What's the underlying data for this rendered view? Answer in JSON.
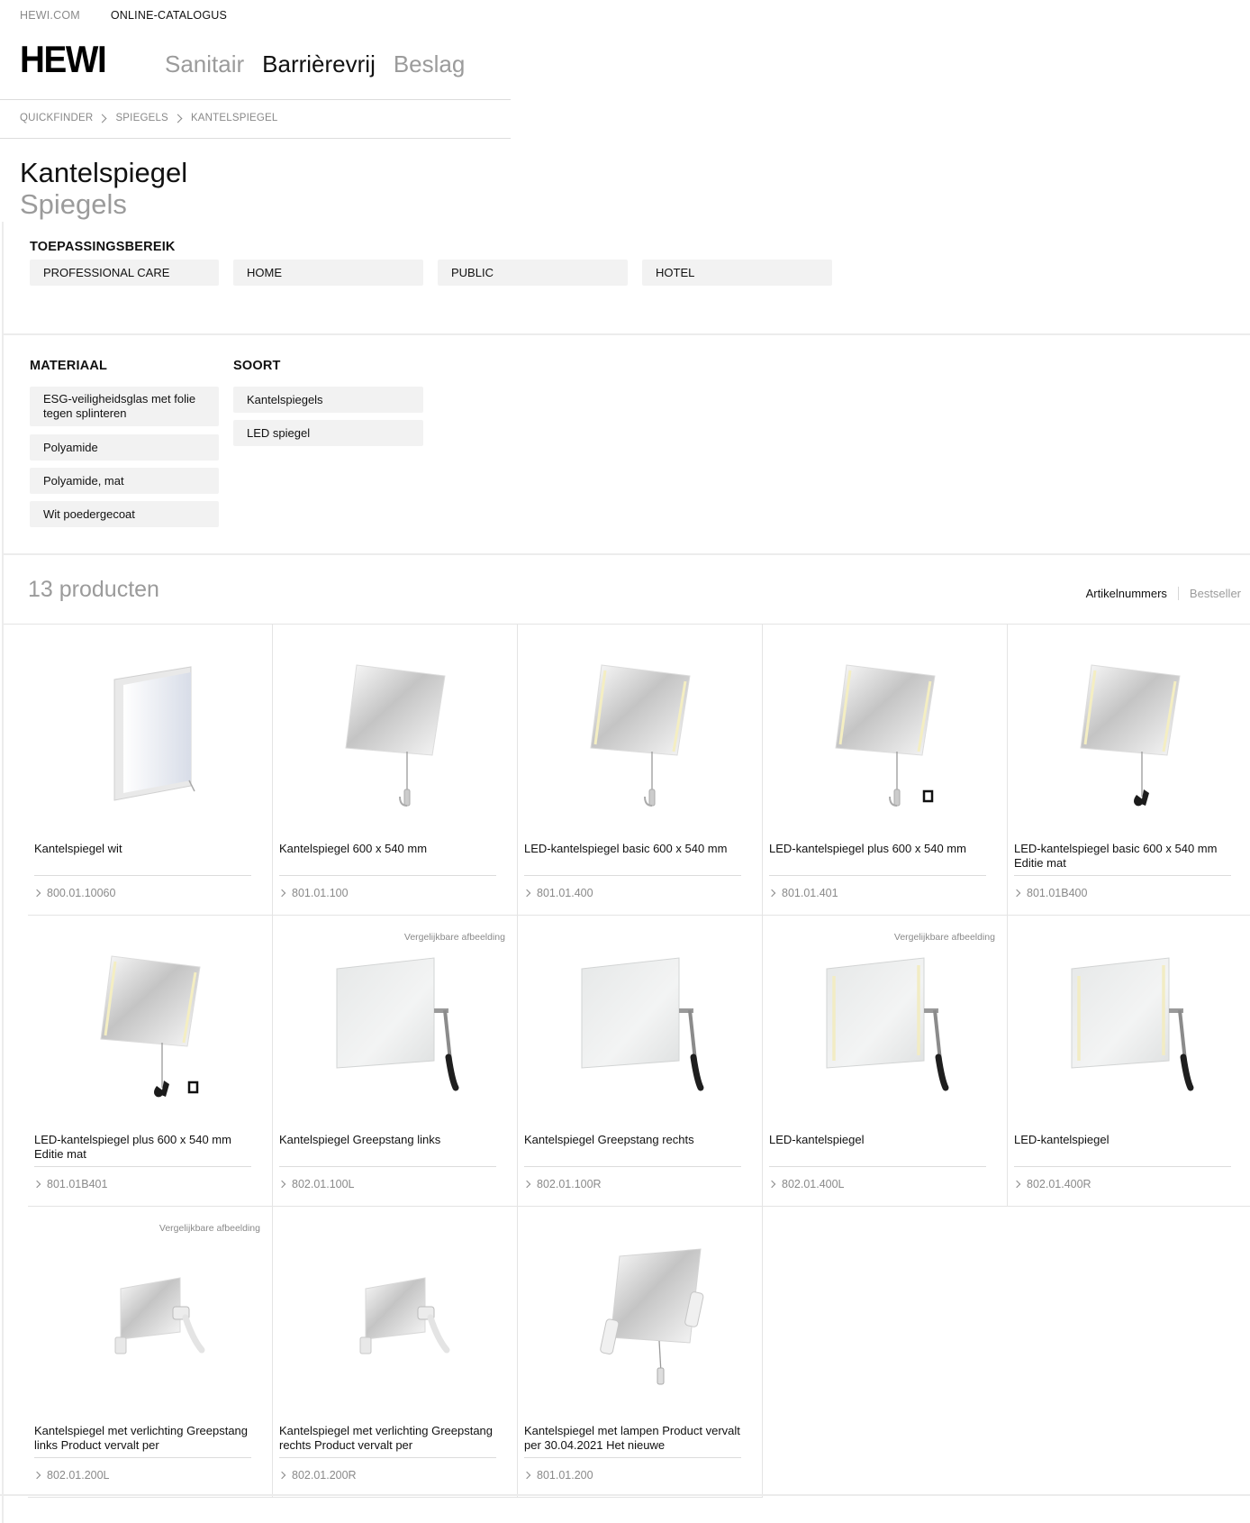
{
  "header": {
    "top_links": [
      "HEWI.COM",
      "ONLINE-CATALOGUS"
    ],
    "logo": "HEWI",
    "nav": [
      {
        "label": "Sanitair",
        "active": false
      },
      {
        "label": "Barrièrevrij",
        "active": true
      },
      {
        "label": "Beslag",
        "active": false
      }
    ]
  },
  "breadcrumb": [
    "QUICKFINDER",
    "SPIEGELS",
    "KANTELSPIEGEL"
  ],
  "page": {
    "title": "Kantelspiegel",
    "subtitle": "Spiegels"
  },
  "filters": {
    "application": {
      "heading": "TOEPASSINGSBEREIK",
      "options": [
        "PROFESSIONAL CARE",
        "HOME",
        "PUBLIC",
        "HOTEL"
      ]
    },
    "material": {
      "heading": "MATERIAAL",
      "options": [
        "ESG-veiligheidsglas met folie tegen splinteren",
        "Polyamide",
        "Polyamide, mat",
        "Wit poedergecoat"
      ]
    },
    "type": {
      "heading": "SOORT",
      "options": [
        "Kantelspiegels",
        "LED spiegel"
      ]
    }
  },
  "results": {
    "count_label": "13 producten",
    "sort_options": [
      {
        "label": "Artikelnummers",
        "active": true
      },
      {
        "label": "Bestseller",
        "active": false
      }
    ]
  },
  "products": [
    {
      "name": "Kantelspiegel wit",
      "article": "800.01.10060",
      "note": "",
      "image": "flat-mirror"
    },
    {
      "name": "Kantelspiegel 600 x 540 mm",
      "article": "801.01.100",
      "note": "",
      "image": "tilt-mirror"
    },
    {
      "name": "LED-kantelspiegel basic 600 x 540 mm",
      "article": "801.01.400",
      "note": "",
      "image": "tilt-led"
    },
    {
      "name": "LED-kantelspiegel plus 600 x 540 mm",
      "article": "801.01.401",
      "note": "",
      "image": "tilt-led-plus"
    },
    {
      "name": "LED-kantelspiegel basic 600 x 540 mm Editie mat",
      "article": "801.01B400",
      "note": "",
      "image": "tilt-led-dark"
    },
    {
      "name": "LED-kantelspiegel plus 600 x 540 mm Editie mat",
      "article": "801.01B401",
      "note": "",
      "image": "tilt-led-dark-plus"
    },
    {
      "name": "Kantelspiegel Greepstang links",
      "article": "802.01.100L",
      "note": "Vergelijkbare afbeelding",
      "image": "lever-mirror"
    },
    {
      "name": "Kantelspiegel Greepstang rechts",
      "article": "802.01.100R",
      "note": "",
      "image": "lever-mirror"
    },
    {
      "name": "LED-kantelspiegel",
      "article": "802.01.400L",
      "note": "Vergelijkbare afbeelding",
      "image": "lever-led"
    },
    {
      "name": "LED-kantelspiegel",
      "article": "802.01.400R",
      "note": "",
      "image": "lever-led"
    },
    {
      "name": "Kantelspiegel met verlichting Greepstang links Product vervalt per",
      "article": "802.01.200L",
      "note": "Vergelijkbare afbeelding",
      "image": "small-lever"
    },
    {
      "name": "Kantelspiegel met verlichting Greepstang rechts Product vervalt per",
      "article": "802.01.200R",
      "note": "",
      "image": "small-lever"
    },
    {
      "name": "Kantelspiegel met lampen Product vervalt per 30.04.2021 Het nieuwe",
      "article": "801.01.200",
      "note": "",
      "image": "lamp-mirror"
    }
  ]
}
